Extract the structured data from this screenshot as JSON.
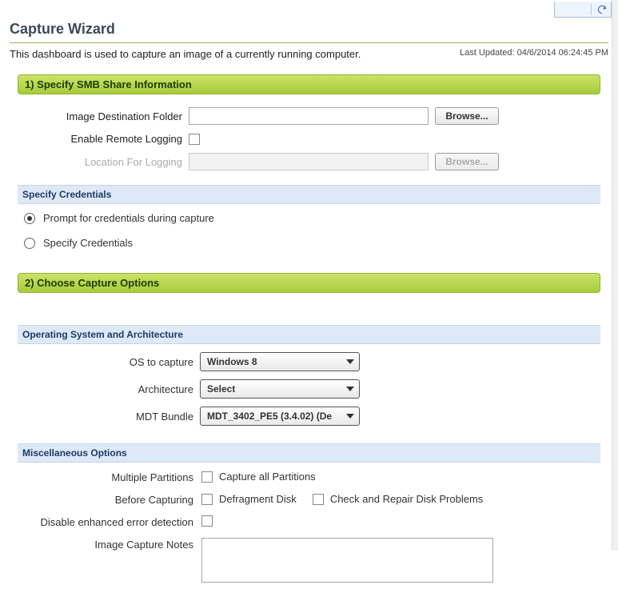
{
  "page": {
    "title": "Capture Wizard",
    "description": "This dashboard is used to capture an image of a currently running computer.",
    "last_updated": "Last Updated: 04/6/2014 06:24:45 PM"
  },
  "section1": {
    "header": "1) Specify SMB Share Information",
    "image_dest_label": "Image Destination Folder",
    "image_dest_value": "",
    "browse1": "Browse...",
    "enable_remote_label": "Enable Remote Logging",
    "location_label": "Location For Logging",
    "location_value": "",
    "browse2": "Browse...",
    "cred_header": "Specify Credentials",
    "radio_prompt": "Prompt for credentials during capture",
    "radio_specify": "Specify Credentials"
  },
  "section2": {
    "header": "2) Choose Capture Options",
    "os_header": "Operating System and Architecture",
    "os_label": "OS to capture",
    "os_value": "Windows 8",
    "arch_label": "Architecture",
    "arch_value": "Select",
    "mdt_label": "MDT Bundle",
    "mdt_value": "MDT_3402_PE5 (3.4.02) (De",
    "misc_header": "Miscellaneous Options",
    "multi_label": "Multiple Partitions",
    "multi_opt": "Capture all Partitions",
    "before_label": "Before Capturing",
    "before_defrag": "Defragment Disk",
    "before_check": "Check and Repair Disk Problems",
    "disable_err_label": "Disable enhanced error detection",
    "notes_label": "Image Capture Notes",
    "notes_value": ""
  }
}
